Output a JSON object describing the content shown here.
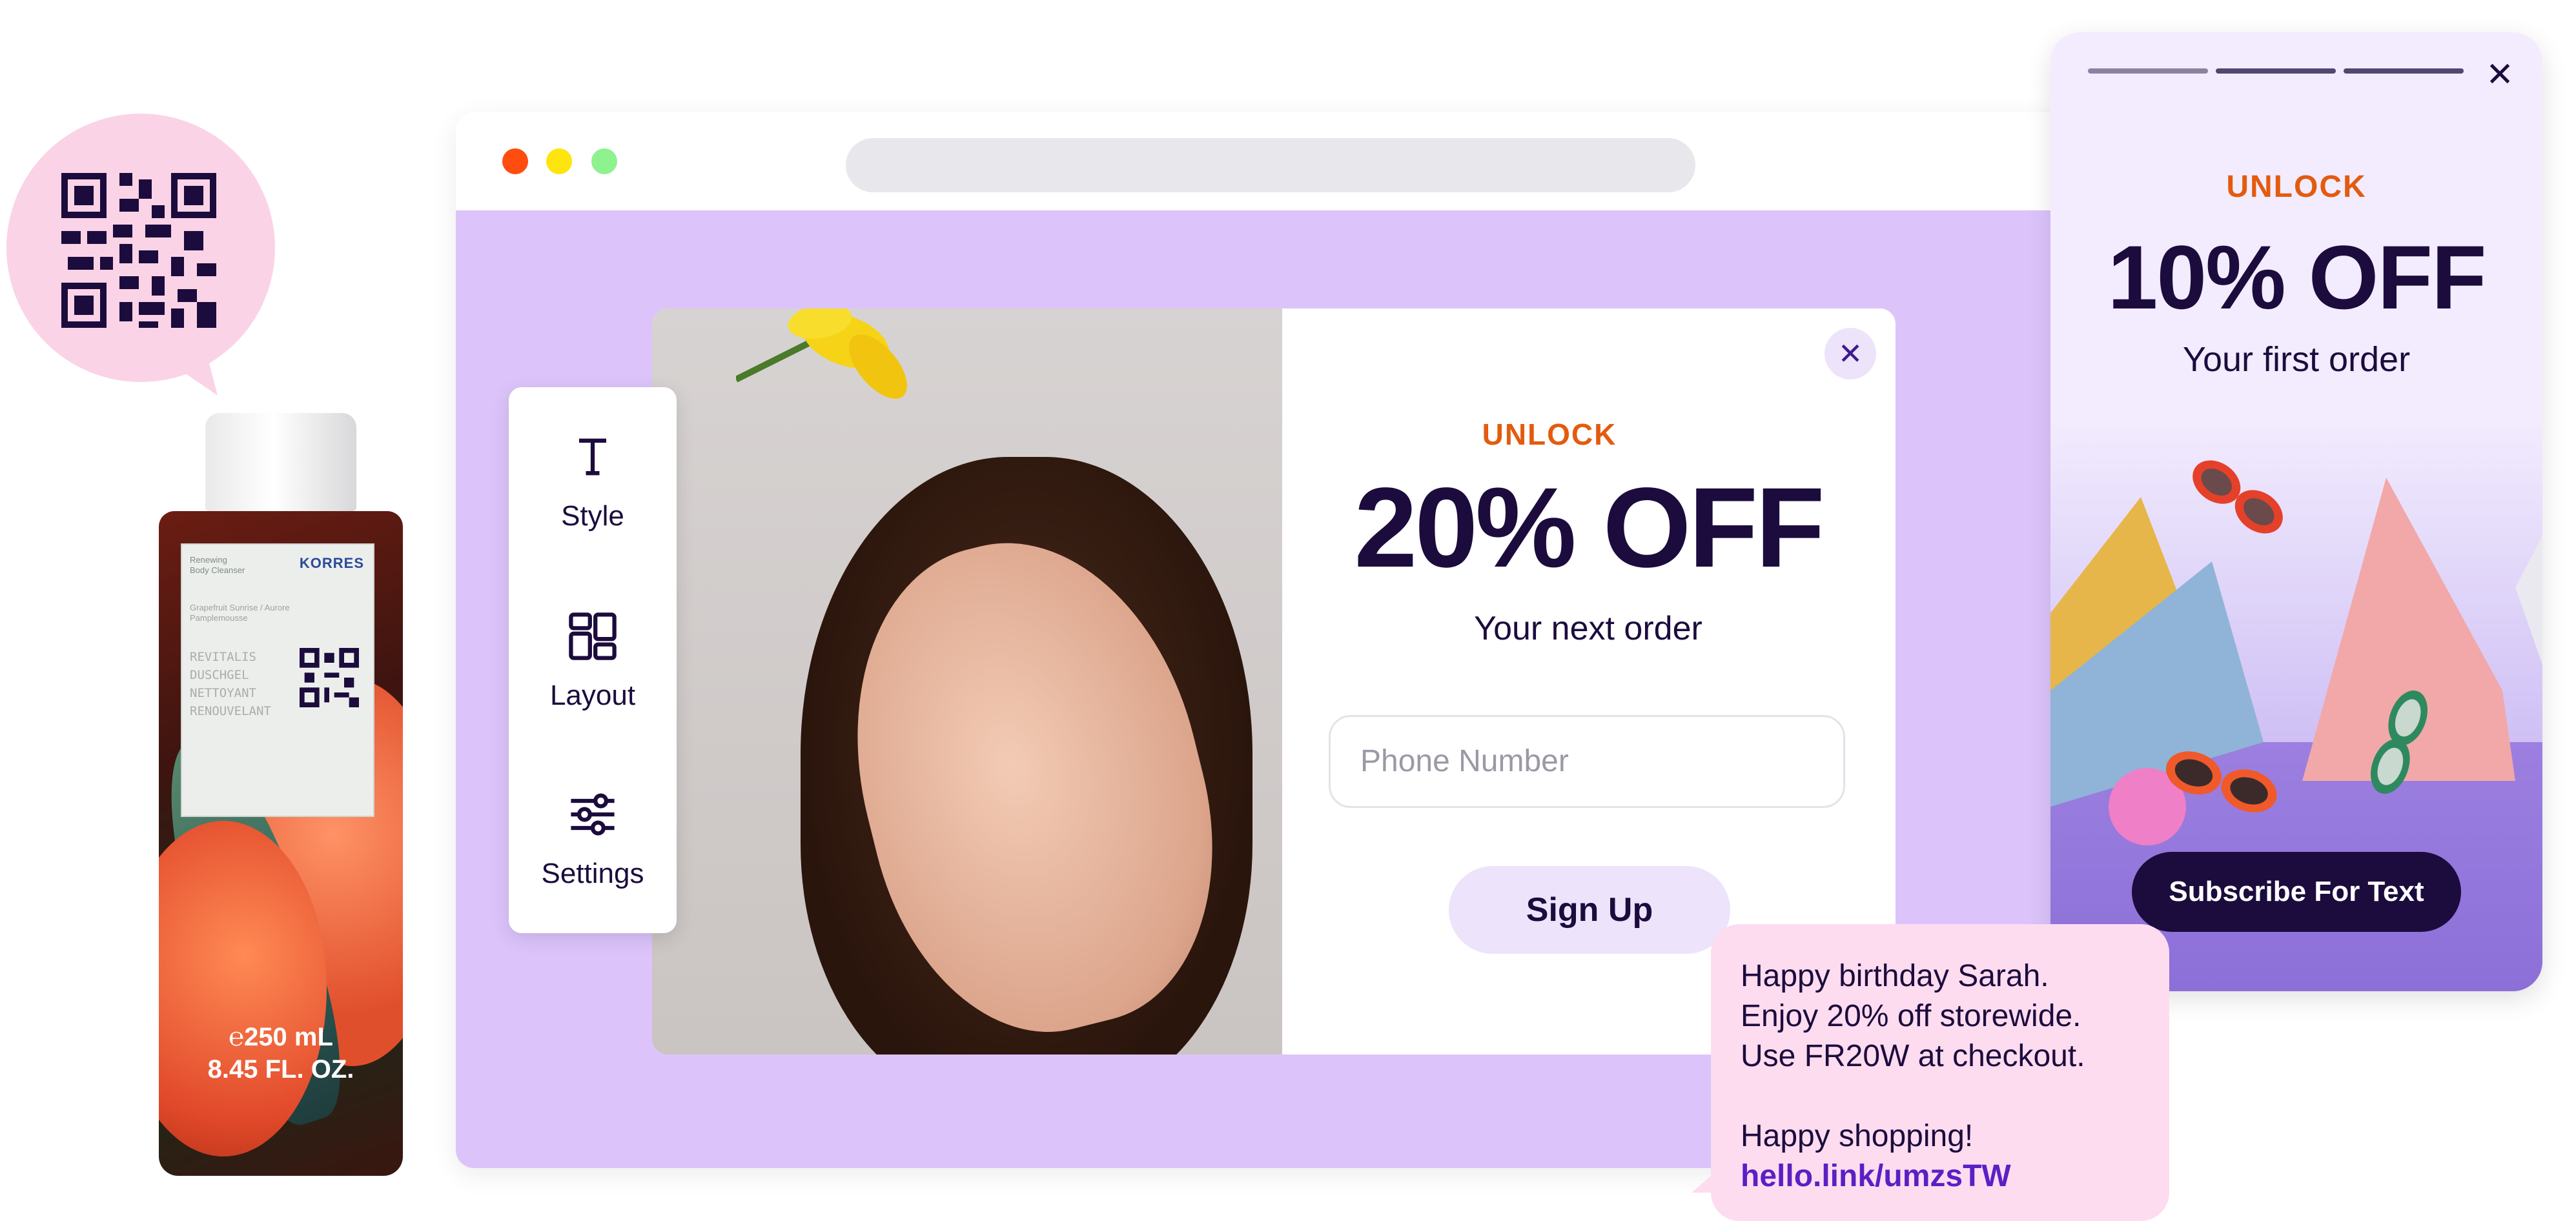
{
  "product": {
    "brand": "KORRES",
    "label_lines": [
      "Renewing",
      "Body Cleanser"
    ],
    "label_sub": "Grapefruit Sunrise / Aurore Pamplemousse",
    "label_mono": [
      "REVITALIS",
      "DUSCHGEL",
      "NETTOYANT",
      "RENOUVELANT"
    ],
    "volume_ml": "℮250 mL",
    "volume_oz": "8.45 FL. OZ."
  },
  "browser": {
    "address": ""
  },
  "popup": {
    "unlock": "UNLOCK",
    "headline": "20% OFF",
    "subhead": "Your next order",
    "phone_placeholder": "Phone Number",
    "signup": "Sign Up",
    "close_glyph": "✕"
  },
  "tools": {
    "style": "Style",
    "layout": "Layout",
    "settings": "Settings"
  },
  "mobile_card": {
    "unlock": "UNLOCK",
    "headline": "10% OFF",
    "subhead": "Your first order",
    "subscribe": "Subscribe For Text",
    "close_glyph": "✕"
  },
  "sms": {
    "line1": "Happy birthday Sarah.",
    "line2": "Enjoy 20% off storewide.",
    "line3": "Use FR20W at checkout.",
    "line4": "Happy shopping!",
    "link": "hello.link/umzsTW"
  },
  "colors": {
    "accent_orange": "#e35b0f",
    "navy": "#1c0c3d",
    "lavender_bg": "#dcc4fb",
    "sms_pink": "#fddcf0"
  }
}
